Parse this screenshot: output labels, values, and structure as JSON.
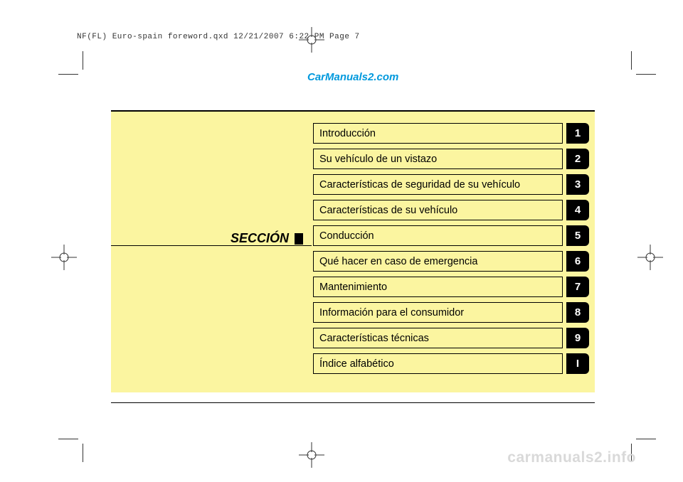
{
  "print_header": "NF(FL) Euro-spain foreword.qxd  12/21/2007  6:22 PM  Page 7",
  "link_top": "CarManuals2.com",
  "watermark": "carmanuals2.info",
  "section_label": "SECCIÓN",
  "toc": [
    {
      "label": "Introducción",
      "num": "1"
    },
    {
      "label": "Su vehículo de un vistazo",
      "num": "2"
    },
    {
      "label": "Características de seguridad de su vehículo",
      "num": "3"
    },
    {
      "label": "Características de su vehículo",
      "num": "4"
    },
    {
      "label": "Conducción",
      "num": "5"
    },
    {
      "label": "Qué hacer en caso de emergencia",
      "num": "6"
    },
    {
      "label": "Mantenimiento",
      "num": "7"
    },
    {
      "label": "Información para el consumidor",
      "num": "8"
    },
    {
      "label": "Características técnicas",
      "num": "9"
    },
    {
      "label": "Índice alfabético",
      "num": "I"
    }
  ]
}
